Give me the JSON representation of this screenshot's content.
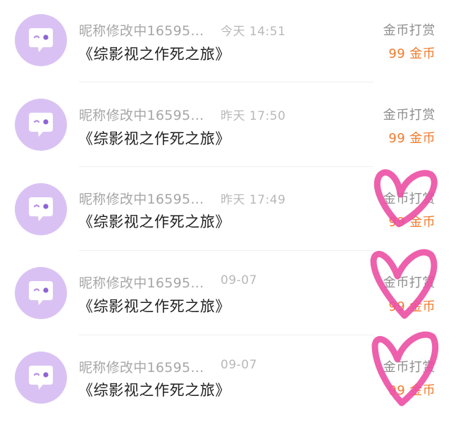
{
  "rows": [
    {
      "nickname": "昵称修改中16595...",
      "time": "今天 14:51",
      "book_title": "《综影视之作死之旅》",
      "type": "金币打赏",
      "amount": "99 金币"
    },
    {
      "nickname": "昵称修改中16595...",
      "time": "昨天 17:50",
      "book_title": "《综影视之作死之旅》",
      "type": "金币打赏",
      "amount": "99 金币"
    },
    {
      "nickname": "昵称修改中16595...",
      "time": "昨天 17:49",
      "book_title": "《综影视之作死之旅》",
      "type": "金币打赏",
      "amount": "99 金币"
    },
    {
      "nickname": "昵称修改中16595...",
      "time": "09-07",
      "book_title": "《综影视之作死之旅》",
      "type": "金币打赏",
      "amount": "99 金币"
    },
    {
      "nickname": "昵称修改中16595...",
      "time": "09-07",
      "book_title": "《综影视之作死之旅》",
      "type": "金币打赏",
      "amount": "99 金币"
    }
  ],
  "colors": {
    "avatar_bg": "#d9c2f3",
    "amount": "#f07a2d",
    "heart_doodle": "#ec4fa4"
  },
  "icons": {
    "avatar": "chat-bubble-wink-icon"
  }
}
